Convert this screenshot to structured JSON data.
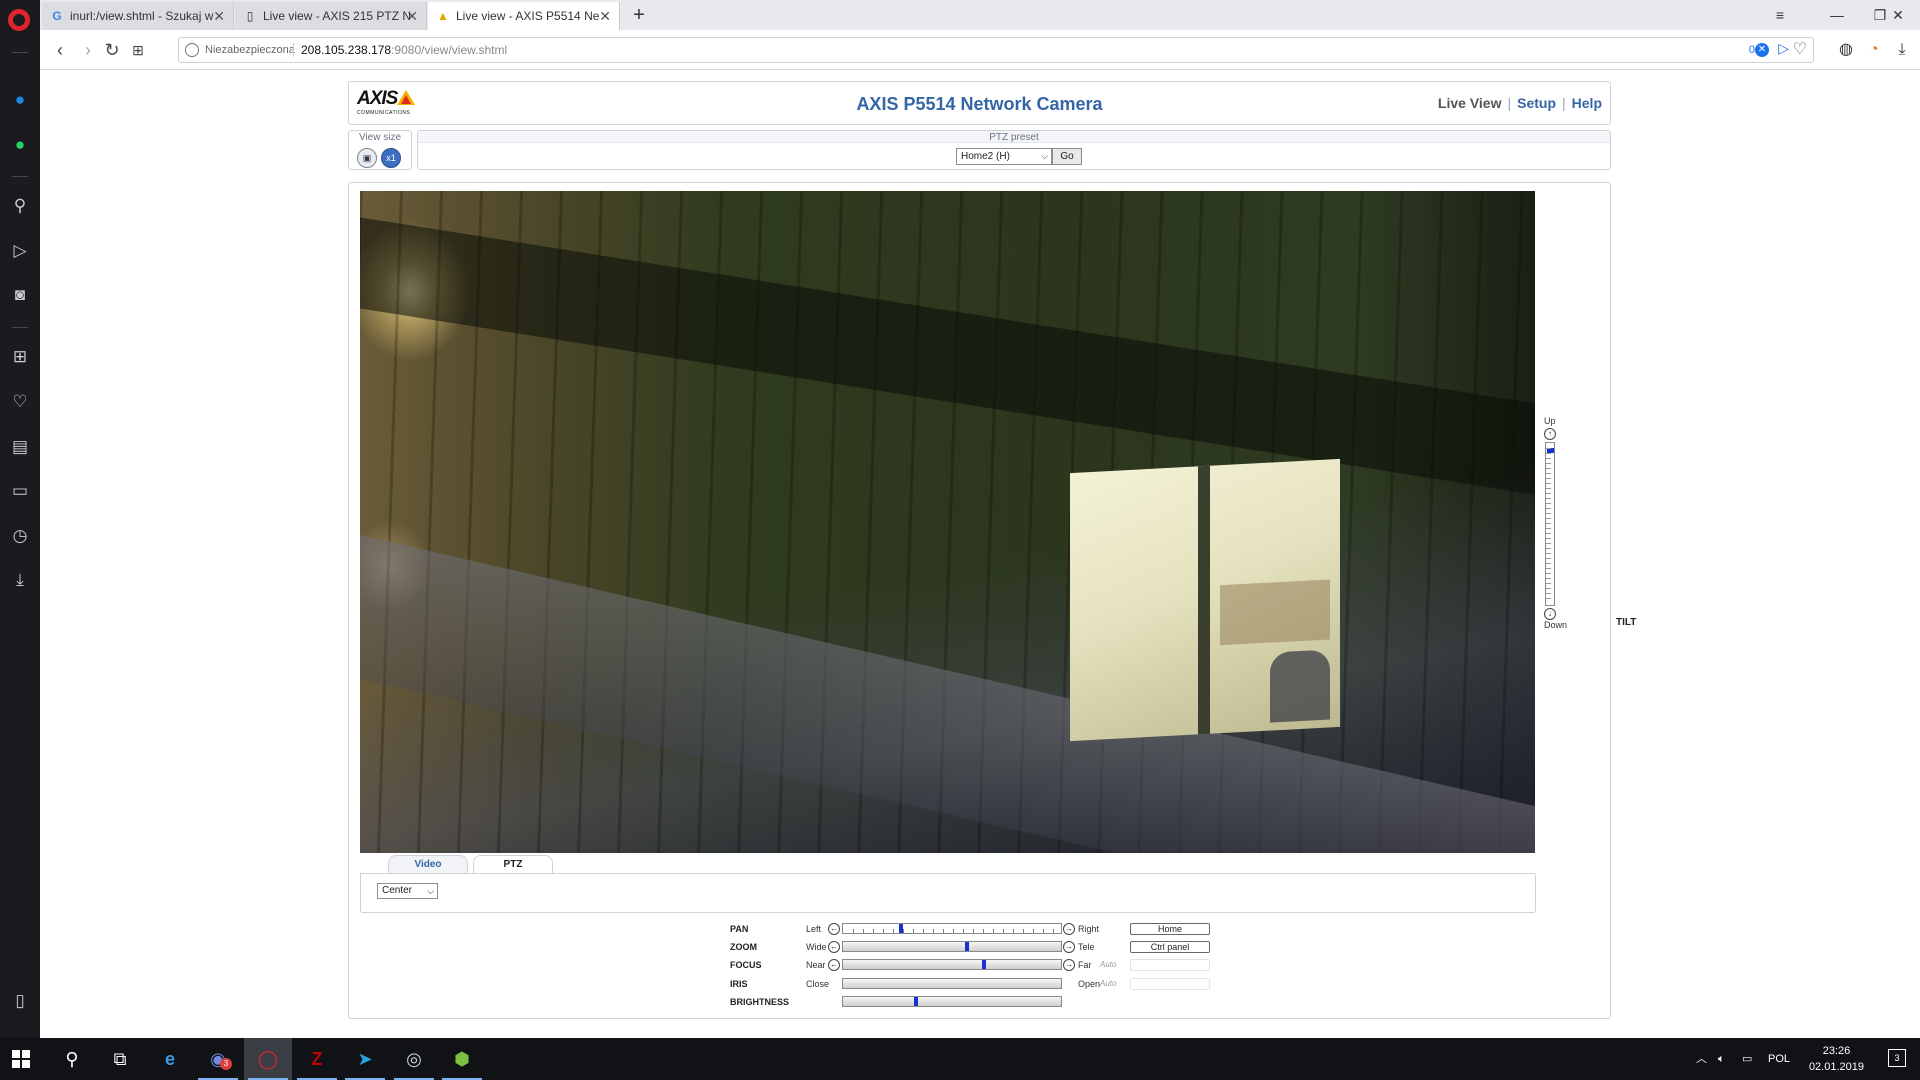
{
  "browser": {
    "tabs": [
      {
        "label": "inurl:/view.shtml - Szukaj w",
        "favicon": "google-g-icon",
        "active": false
      },
      {
        "label": "Live view - AXIS 215 PTZ N",
        "favicon": "page-icon",
        "active": false
      },
      {
        "label": "Live view - AXIS P5514 Ne",
        "favicon": "axis-triangle-icon",
        "active": true
      }
    ],
    "address": {
      "security_label": "Niezabezpieczona",
      "host": "208.105.238.178",
      "rest": ":9080/view/view.shtml",
      "badge_count": "0"
    }
  },
  "camera": {
    "logo_word": "AXIS",
    "logo_sub": "COMMUNICATIONS",
    "title": "AXIS P5514 Network Camera",
    "nav": {
      "live_view": "Live View",
      "setup": "Setup",
      "help": "Help"
    },
    "view_size_label": "View size",
    "view_size_buttons": [
      "fit-icon",
      "x1-icon"
    ],
    "view_size_x1": "x1",
    "ptz_preset_label": "PTZ preset",
    "ptz_preset_value": "Home2 (H)",
    "go_label": "Go",
    "tilt": {
      "up": "Up",
      "down": "Down",
      "label": "TILT",
      "position": 0.03
    },
    "tabs": {
      "video": "Video",
      "ptz": "PTZ",
      "active": "PTZ"
    },
    "center_select": "Center",
    "controls": [
      {
        "name": "PAN",
        "min": "Left",
        "max": "Right",
        "auto": "",
        "arrows": true,
        "value": 0.26,
        "ticks": true,
        "button": "Home"
      },
      {
        "name": "ZOOM",
        "min": "Wide",
        "max": "Tele",
        "auto": "",
        "arrows": true,
        "value": 0.57,
        "ticks": false,
        "button": "Ctrl panel"
      },
      {
        "name": "FOCUS",
        "min": "Near",
        "max": "Far",
        "auto": "Auto",
        "arrows": true,
        "value": 0.65,
        "ticks": false,
        "button": ""
      },
      {
        "name": "IRIS",
        "min": "Close",
        "max": "Open",
        "auto": "Auto",
        "arrows": false,
        "value": null,
        "ticks": false,
        "button": ""
      },
      {
        "name": "BRIGHTNESS",
        "min": "",
        "max": "",
        "auto": "",
        "arrows": false,
        "value": 0.33,
        "ticks": false,
        "button": null
      }
    ]
  },
  "taskbar": {
    "language": "POL",
    "time": "23:26",
    "date": "02.01.2019",
    "notifications": "3",
    "discord_badge": "3",
    "apps": [
      "search-icon",
      "task-view-icon",
      "edge-icon",
      "discord-icon",
      "opera-icon",
      "filezilla-icon",
      "telegram-icon",
      "steam-icon",
      "hotspot-shield-icon"
    ]
  }
}
